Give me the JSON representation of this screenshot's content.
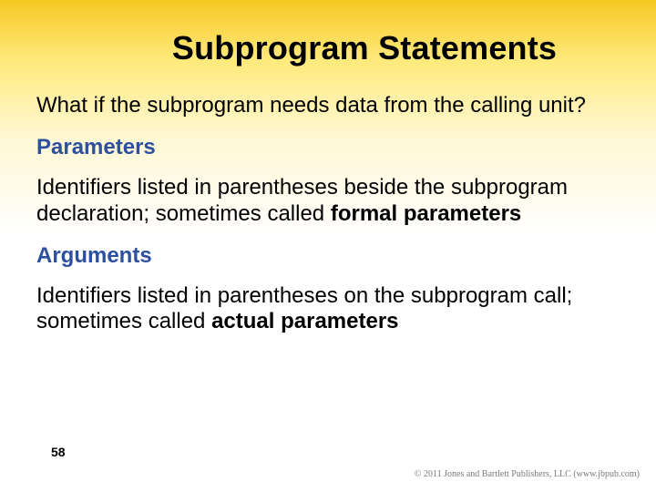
{
  "slide": {
    "title": "Subprogram Statements",
    "intro": "What if the subprogram needs data from the calling unit?",
    "term1": "Parameters",
    "def1_a": "Identifiers listed in parentheses beside the subprogram declaration; sometimes called ",
    "def1_b": "formal parameters",
    "term2": "Arguments",
    "def2_a": "Identifiers listed in parentheses on the subprogram call; sometimes called ",
    "def2_b": "actual parameters",
    "page_number": "58",
    "copyright": "© 2011 Jones and Bartlett Publishers, LLC (www.jbpub.com)"
  }
}
